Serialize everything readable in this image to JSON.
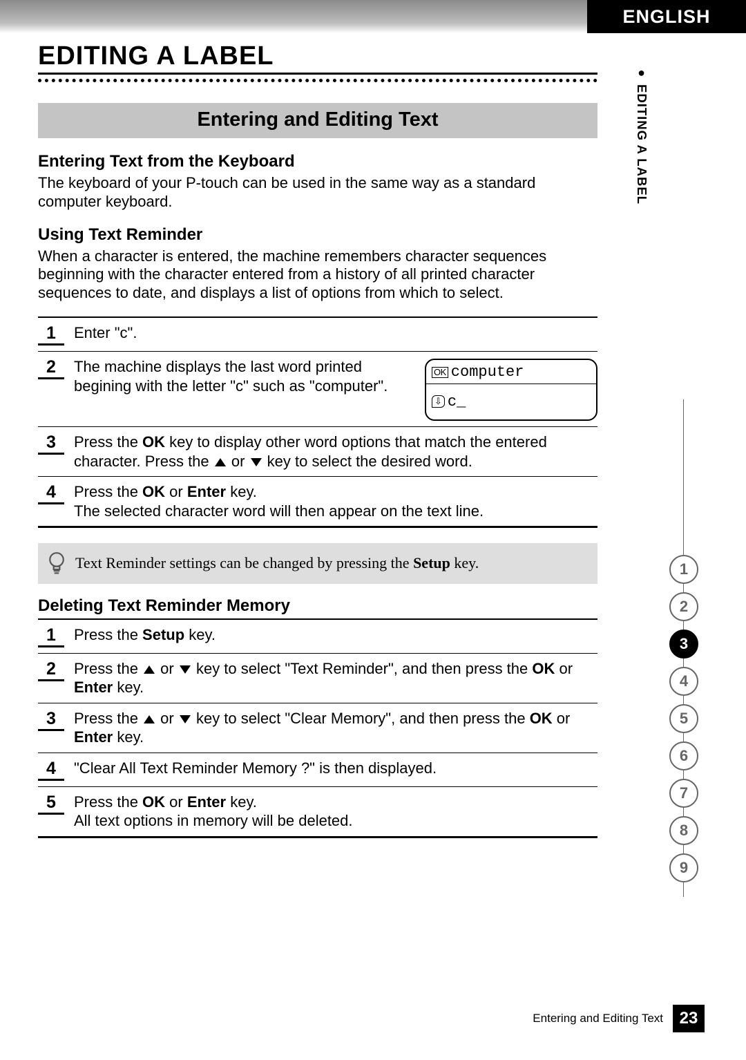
{
  "header": {
    "language": "ENGLISH"
  },
  "side_tab": {
    "bullet": "●",
    "text": "EDITING A LABEL"
  },
  "chapter_title": "EDITING A LABEL",
  "section_banner": "Entering and Editing Text",
  "sub1": {
    "heading": "Entering Text from the Keyboard",
    "body": "The keyboard of your P-touch can be used in the same way as a standard computer keyboard."
  },
  "sub2": {
    "heading": "Using Text Reminder",
    "body": "When a character is entered, the machine remembers character sequences beginning with the character entered from a history of all printed character sequences to date, and displays a list of options from which to select."
  },
  "steps_a": {
    "s1": {
      "num": "1",
      "text": "Enter \"c\"."
    },
    "s2": {
      "num": "2",
      "text": "The machine displays the last word printed begining with the letter \"c\" such as \"computer\".",
      "screen": {
        "ok": "OK",
        "word": "computer",
        "ret": "⇩",
        "cursor": "c_"
      }
    },
    "s3": {
      "num": "3",
      "pre": "Press the ",
      "ok": "OK",
      "mid1": " key to display other word options that match the entered character. Press the ",
      "mid2": " or ",
      "post": " key to select the desired word."
    },
    "s4": {
      "num": "4",
      "pre": "Press the ",
      "ok": "OK",
      "or": " or ",
      "enter": "Enter",
      "post": " key.",
      "line2": "The selected character word will then appear on the text line."
    }
  },
  "tip": {
    "pre": "Text Reminder settings can be changed by pressing the ",
    "setup": "Setup",
    "post": " key."
  },
  "sub3": {
    "heading": "Deleting Text Reminder Memory"
  },
  "steps_b": {
    "s1": {
      "num": "1",
      "pre": "Press the ",
      "setup": "Setup",
      "post": " key."
    },
    "s2": {
      "num": "2",
      "pre": "Press the ",
      "mid1": " or ",
      "mid2": " key to select \"Text Reminder\", and then press the ",
      "ok": "OK",
      "or": " or ",
      "enter": "Enter",
      "post": " key."
    },
    "s3": {
      "num": "3",
      "pre": "Press the ",
      "mid1": " or ",
      "mid2": " key to select \"Clear Memory\", and then press the ",
      "ok": "OK",
      "or": " or ",
      "enter": "Enter",
      "post": " key."
    },
    "s4": {
      "num": "4",
      "text": "\"Clear All Text Reminder Memory ?\" is then displayed."
    },
    "s5": {
      "num": "5",
      "pre": "Press the ",
      "ok": "OK",
      "or": " or ",
      "enter": "Enter",
      "post": " key.",
      "line2": "All text options in memory will be deleted."
    }
  },
  "nav": {
    "items": [
      "1",
      "2",
      "3",
      "4",
      "5",
      "6",
      "7",
      "8",
      "9"
    ],
    "active_index": 2
  },
  "footer": {
    "text": "Entering and Editing Text",
    "page": "23"
  }
}
